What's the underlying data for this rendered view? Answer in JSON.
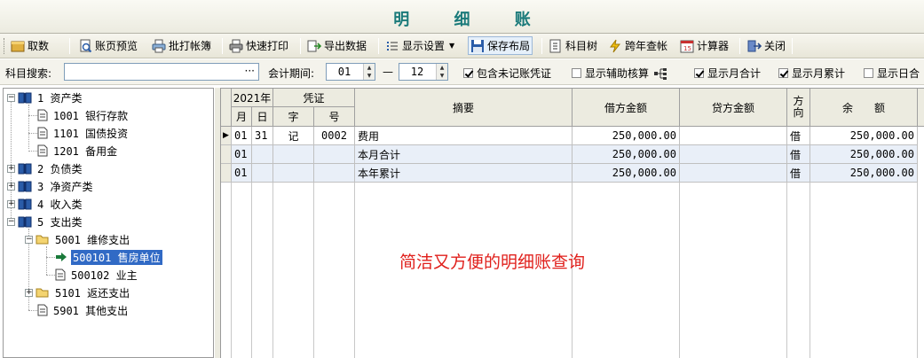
{
  "window": {
    "title": "明 细 账"
  },
  "toolbar": {
    "cancel": "取数",
    "preview": "账页预览",
    "batch_print": "批打帐簿",
    "quick_print": "快速打印",
    "export": "导出数据",
    "display_settings": "显示设置",
    "save_layout": "保存布局",
    "account_tree": "科目树",
    "cross_year": "跨年查帐",
    "calculator": "计算器",
    "close": "关闭"
  },
  "filter": {
    "search_label": "科目搜索:",
    "search_value": "",
    "search_button": "···",
    "period_label": "会计期间:",
    "period_from": "01",
    "period_sep": "—",
    "period_to": "12",
    "options": [
      {
        "label": "包含未记账凭证",
        "checked": true
      },
      {
        "label": "显示辅助核算",
        "checked": false
      },
      {
        "label": "显示月合计",
        "checked": true
      },
      {
        "label": "显示月累计",
        "checked": true
      },
      {
        "label": "显示日合",
        "checked": false
      }
    ]
  },
  "tree": {
    "nodes": [
      {
        "label": "1 资产类",
        "type": "book",
        "expanded": true
      },
      {
        "label": "1001 银行存款",
        "type": "doc"
      },
      {
        "label": "1101 国债投资",
        "type": "doc"
      },
      {
        "label": "1201 备用金",
        "type": "doc"
      },
      {
        "label": "2 负债类",
        "type": "book",
        "expanded": false
      },
      {
        "label": "3 净资产类",
        "type": "book",
        "expanded": false
      },
      {
        "label": "4 收入类",
        "type": "book",
        "expanded": false
      },
      {
        "label": "5 支出类",
        "type": "book",
        "expanded": true
      },
      {
        "label": "5001 维修支出",
        "type": "folder",
        "expanded": true
      },
      {
        "label": "500101 售房单位",
        "type": "doc",
        "selected": true
      },
      {
        "label": "500102 业主",
        "type": "doc"
      },
      {
        "label": "5101 返还支出",
        "type": "folder",
        "expanded": false
      },
      {
        "label": "5901 其他支出",
        "type": "doc"
      }
    ]
  },
  "grid": {
    "headers": {
      "year": "2021年",
      "voucher": "凭证",
      "month": "月",
      "day": "日",
      "word": "字",
      "number": "号",
      "summary": "摘要",
      "debit": "借方金额",
      "credit": "贷方金额",
      "direction": "方向",
      "balance": "余　　额"
    },
    "rows": [
      {
        "month": "01",
        "day": "31",
        "word": "记",
        "number": "0002",
        "summary": "费用",
        "debit": "250,000.00",
        "credit": "",
        "direction": "借",
        "balance": "250,000.00",
        "current": true
      },
      {
        "month": "01",
        "day": "",
        "word": "",
        "number": "",
        "summary": "本月合计",
        "debit": "250,000.00",
        "credit": "",
        "direction": "借",
        "balance": "250,000.00",
        "current": false
      },
      {
        "month": "01",
        "day": "",
        "word": "",
        "number": "",
        "summary": "本年累计",
        "debit": "250,000.00",
        "credit": "",
        "direction": "借",
        "balance": "250,000.00",
        "current": false
      }
    ]
  },
  "annotation": "简洁又方便的明细账查询",
  "colors": {
    "title": "#1a7a7a",
    "annotation": "#e0201c",
    "selection": "#316ac5"
  }
}
